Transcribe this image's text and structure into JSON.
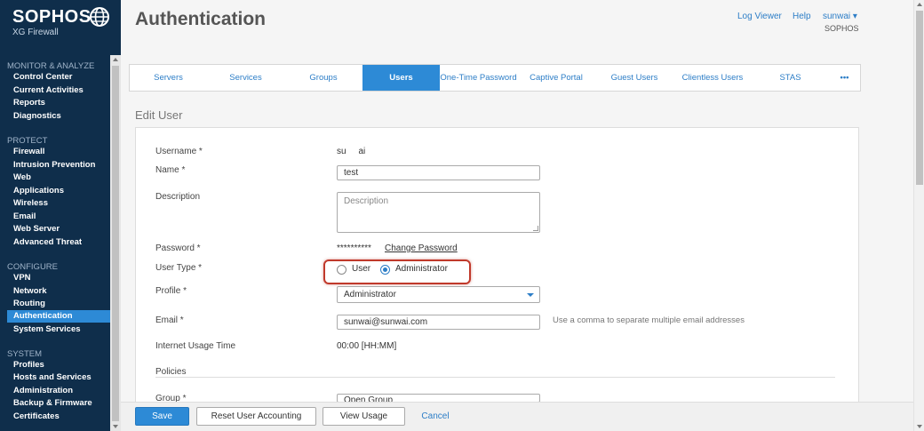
{
  "brand": {
    "name": "SOPHOS",
    "product": "XG Firewall"
  },
  "sidebar": {
    "sections": [
      {
        "title": "MONITOR & ANALYZE",
        "items": [
          "Control Center",
          "Current Activities",
          "Reports",
          "Diagnostics"
        ]
      },
      {
        "title": "PROTECT",
        "items": [
          "Firewall",
          "Intrusion Prevention",
          "Web",
          "Applications",
          "Wireless",
          "Email",
          "Web Server",
          "Advanced Threat"
        ]
      },
      {
        "title": "CONFIGURE",
        "items": [
          "VPN",
          "Network",
          "Routing",
          "Authentication",
          "System Services"
        ]
      },
      {
        "title": "SYSTEM",
        "items": [
          "Profiles",
          "Hosts and Services",
          "Administration",
          "Backup & Firmware",
          "Certificates"
        ]
      }
    ],
    "active_item": "Authentication"
  },
  "header": {
    "title": "Authentication",
    "log_viewer": "Log Viewer",
    "help": "Help",
    "user": "sunwai ▾",
    "org": "SOPHOS"
  },
  "tabs": [
    "Servers",
    "Services",
    "Groups",
    "Users",
    "One-Time Password",
    "Captive Portal",
    "Guest Users",
    "Clientless Users",
    "STAS",
    "•••"
  ],
  "active_tab": "Users",
  "form": {
    "section_title": "Edit User",
    "username_label": "Username *",
    "username_value": "su     ai",
    "name_label": "Name *",
    "name_value": "test",
    "description_label": "Description",
    "description_placeholder": "Description",
    "password_label": "Password *",
    "password_mask": "**********",
    "change_password": "Change Password",
    "user_type_label": "User Type *",
    "user_type_options": [
      "User",
      "Administrator"
    ],
    "user_type_selected": "Administrator",
    "profile_label": "Profile *",
    "profile_value": "Administrator",
    "email_label": "Email *",
    "email_value": "sunwai@sunwai.com",
    "email_hint": "Use a comma to separate multiple email addresses",
    "usage_label": "Internet Usage Time",
    "usage_value": "00:00 [HH:MM]",
    "policies_label": "Policies",
    "group_label": "Group *",
    "group_value": "Open Group"
  },
  "footer": {
    "save": "Save",
    "reset": "Reset User Accounting",
    "view_usage": "View Usage",
    "cancel": "Cancel"
  },
  "colors": {
    "sidebar_bg": "#0f2e4b",
    "accent": "#2d8ad6",
    "highlight_border": "#c0392b"
  }
}
